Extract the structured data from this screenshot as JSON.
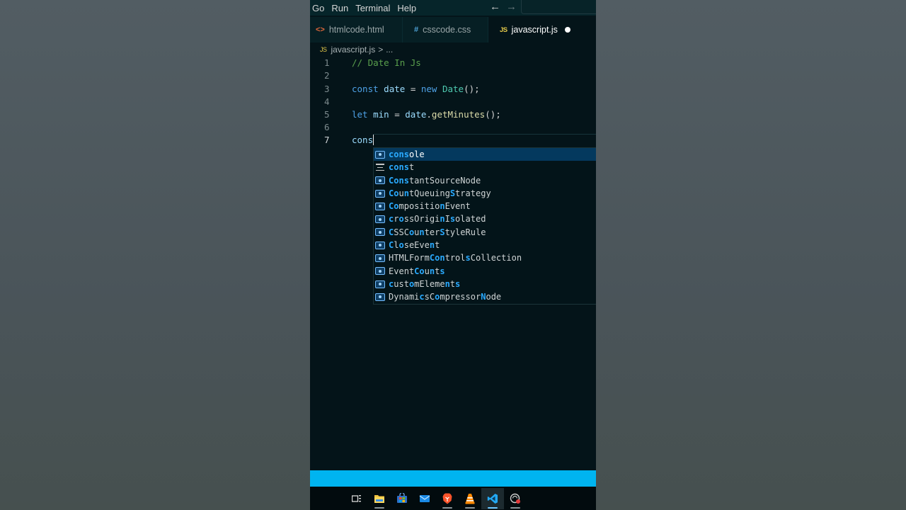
{
  "menu": {
    "items": [
      "Go",
      "Run",
      "Terminal",
      "Help"
    ],
    "back_arrow": "←",
    "forward_arrow": "→"
  },
  "tabs": [
    {
      "icon_text": "<>",
      "icon": "html-file-icon",
      "label": "htmlcode.html",
      "active": false
    },
    {
      "icon_text": "#",
      "icon": "css-file-icon",
      "label": "csscode.css",
      "active": false
    },
    {
      "icon_text": "JS",
      "icon": "js-file-icon",
      "label": "javascript.js",
      "active": true,
      "unsaved": true
    }
  ],
  "breadcrumb": {
    "icon_text": "JS",
    "file": "javascript.js",
    "separator": ">",
    "rest": "..."
  },
  "editor": {
    "lines": [
      {
        "number": "1",
        "text": "// Date In Js"
      },
      {
        "number": "2",
        "text": ""
      },
      {
        "number": "3",
        "text": "const date = new Date();"
      },
      {
        "number": "4",
        "text": ""
      },
      {
        "number": "5",
        "text": "let min = date.getMinutes();"
      },
      {
        "number": "6",
        "text": ""
      },
      {
        "number": "7",
        "text": "cons"
      }
    ],
    "active_line": "7"
  },
  "suggestions": [
    {
      "label": "console",
      "kind": "variable",
      "selected": true
    },
    {
      "label": "const",
      "kind": "keyword",
      "selected": false
    },
    {
      "label": "ConstantSourceNode",
      "kind": "variable",
      "selected": false
    },
    {
      "label": "CountQueuingStrategy",
      "kind": "variable",
      "selected": false
    },
    {
      "label": "CompositionEvent",
      "kind": "variable",
      "selected": false
    },
    {
      "label": "crossOriginIsolated",
      "kind": "variable",
      "selected": false
    },
    {
      "label": "CSSCounterStyleRule",
      "kind": "variable",
      "selected": false
    },
    {
      "label": "CloseEvent",
      "kind": "variable",
      "selected": false
    },
    {
      "label": "HTMLFormControlsCollection",
      "kind": "variable",
      "selected": false
    },
    {
      "label": "EventCounts",
      "kind": "variable",
      "selected": false
    },
    {
      "label": "customElements",
      "kind": "variable",
      "selected": false
    },
    {
      "label": "DynamicsCompressorNode",
      "kind": "variable",
      "selected": false
    }
  ],
  "colors": {
    "editor_bg": "#041419",
    "status_bar": "#00b4f0",
    "selection": "#04395e",
    "match_highlight": "#2aaaff"
  },
  "taskbar": {
    "apps": [
      "task-view-icon",
      "file-explorer-icon",
      "store-icon",
      "mail-icon",
      "brave-browser-icon",
      "vlc-icon",
      "vscode-icon",
      "app-icon"
    ],
    "active_app": "vscode-icon"
  }
}
